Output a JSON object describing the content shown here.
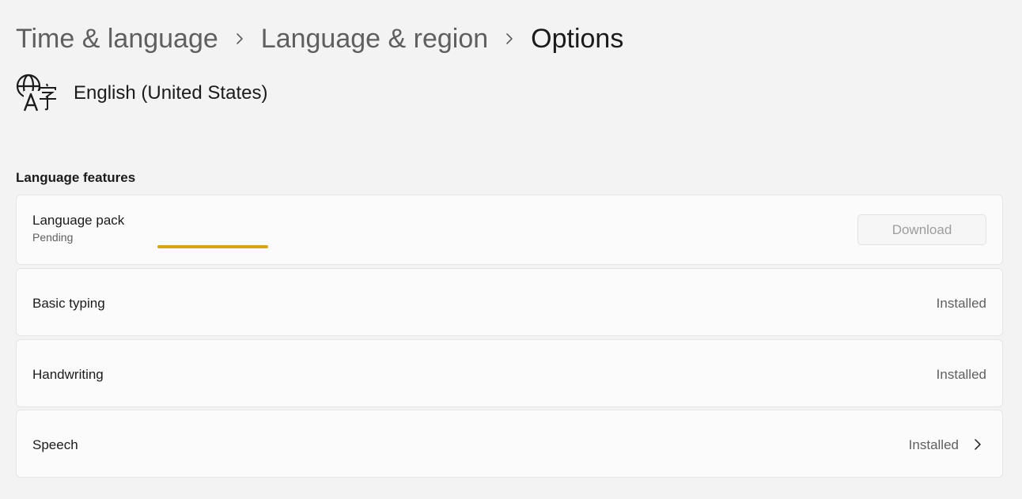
{
  "breadcrumb": {
    "items": [
      "Time & language",
      "Language & region",
      "Options"
    ]
  },
  "header": {
    "language_name": "English (United States)",
    "icon": "language-globe-icon"
  },
  "section": {
    "title": "Language features"
  },
  "features": {
    "language_pack": {
      "label": "Language pack",
      "status": "Pending",
      "progress_percent": 35,
      "progress_color": "#d9a40f",
      "button_label": "Download",
      "button_enabled": false
    },
    "basic_typing": {
      "label": "Basic typing",
      "status": "Installed"
    },
    "handwriting": {
      "label": "Handwriting",
      "status": "Installed"
    },
    "speech": {
      "label": "Speech",
      "status": "Installed",
      "icon": "chevron-right-icon"
    }
  },
  "colors": {
    "background": "#f3f3f3",
    "card": "#fbfbfb",
    "accent": "#d9a40f"
  }
}
